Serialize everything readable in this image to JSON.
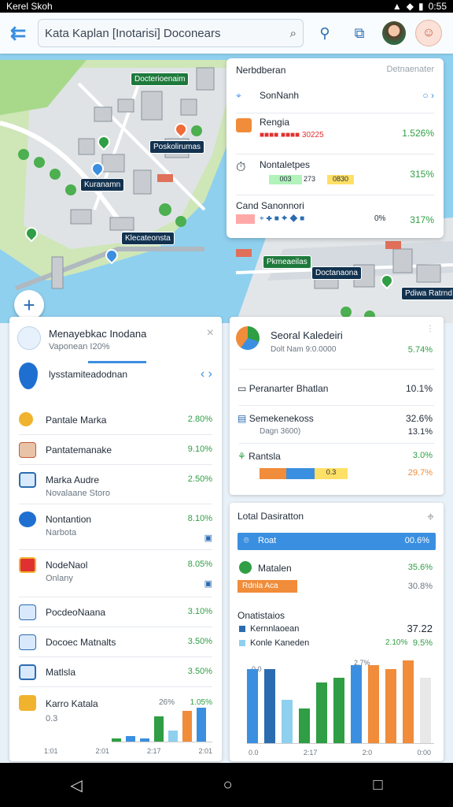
{
  "status": {
    "left": "Kerel Skoh",
    "right": "0:55"
  },
  "search": {
    "text": "Kata Kaplan [Inotarisi] Doconears"
  },
  "map": {
    "labels": [
      "Docterioenaim",
      "Poskolirumas",
      "Kuranamn",
      "Klecateonsta",
      "Pkmeaeilas",
      "Doctanaona",
      "Pdiwa Ratrnd"
    ]
  },
  "summary": {
    "title": "Nerbdberan",
    "subtitle": "Detnaenater",
    "row1": {
      "label": "SonNanh"
    },
    "row2": {
      "label": "Rengia",
      "scores": "■■■■ ■■■■ 30225",
      "value": "1.526%"
    },
    "row3": {
      "label": "Nontaletpes",
      "chips": [
        "003",
        "273",
        "0830"
      ],
      "value": "315%"
    },
    "row4": {
      "label": "Cand Sanonnori",
      "chips": "0%",
      "value": "317%"
    }
  },
  "left_panel": {
    "title": "Menayebkac Inodana",
    "subtitle": "Vaponean I20%",
    "progress_label": "lysstamiteadodnan",
    "rows": [
      {
        "label": "Pantale Marka",
        "value": "2.80%"
      },
      {
        "label": "Pantatemanake",
        "value": "9.10%"
      },
      {
        "label": "Marka Audre",
        "sub": "Novalaane Storo",
        "value": "2.50%"
      },
      {
        "label": "Nontantion",
        "sub": "Narbota",
        "value": "8.10%"
      },
      {
        "label": "NodeNaol",
        "sub": "Onlany",
        "value": "8.05%"
      },
      {
        "label": "PocdeoNaana",
        "value": "3.10%"
      },
      {
        "label": "Docoec Matnalts",
        "value": "3.50%"
      },
      {
        "label": "Matlsla",
        "value": "3.50%"
      },
      {
        "label": "Karro Katala",
        "sub": "0.3",
        "value": "1.05%"
      }
    ],
    "chart": {
      "annotation": "26%",
      "x_ticks": [
        "1:01",
        "2:01",
        "2:17",
        "2:01"
      ]
    }
  },
  "right_top": {
    "title": "Seoral Kaledeiri",
    "subtitle": "Dolt Nam 9:0.0000",
    "header_value": "5.74%",
    "rows": [
      {
        "label": "Peranarter Bhatlan",
        "value": "10.1%"
      },
      {
        "label": "Semekenekoss",
        "sub": "Dagn 3600)",
        "value": "32.6%",
        "value2": "13.1%"
      },
      {
        "label": "Rantsla",
        "value": "3.0%",
        "value2": "29.7%",
        "chip": "0.3"
      }
    ]
  },
  "right_bottom": {
    "title": "Lotal Dasiratton",
    "bar_label": "Roat",
    "bar_value": "00.6%",
    "row_label": "Matalen",
    "row_value": "35.6%",
    "chip_label": "Rdnla Aca",
    "chip_value": "30.8%",
    "stats_title": "Onatistaios",
    "stats": [
      {
        "label": "Kernnlaoean",
        "value": "37.22"
      },
      {
        "label": "Konle Kaneden",
        "value": "2.10%",
        "value2": "9.5%"
      }
    ],
    "chart": {
      "annotation": "2.7%",
      "y_label": "0.0",
      "x_ticks": [
        "0.0",
        "2:17",
        "2:0",
        "0:00"
      ]
    }
  },
  "chart_data": [
    {
      "type": "bar",
      "values": [
        1,
        2,
        1,
        9,
        4,
        11,
        12
      ],
      "colors": [
        "#2f9e44",
        "#3b8fe0",
        "#3b8fe0",
        "#2f9e44",
        "#8fd0ef",
        "#f08c3a",
        "#3b8fe0"
      ]
    },
    {
      "type": "bar",
      "values": [
        17,
        17,
        10,
        8,
        14,
        15,
        18,
        18,
        17,
        19,
        15
      ],
      "colors": [
        "#3b8fe0",
        "#2b6cb0",
        "#8fd0ef",
        "#2f9e44",
        "#2f9e44",
        "#2f9e44",
        "#3b8fe0",
        "#f08c3a",
        "#f08c3a",
        "#f08c3a",
        "#e8e8e8"
      ]
    }
  ]
}
